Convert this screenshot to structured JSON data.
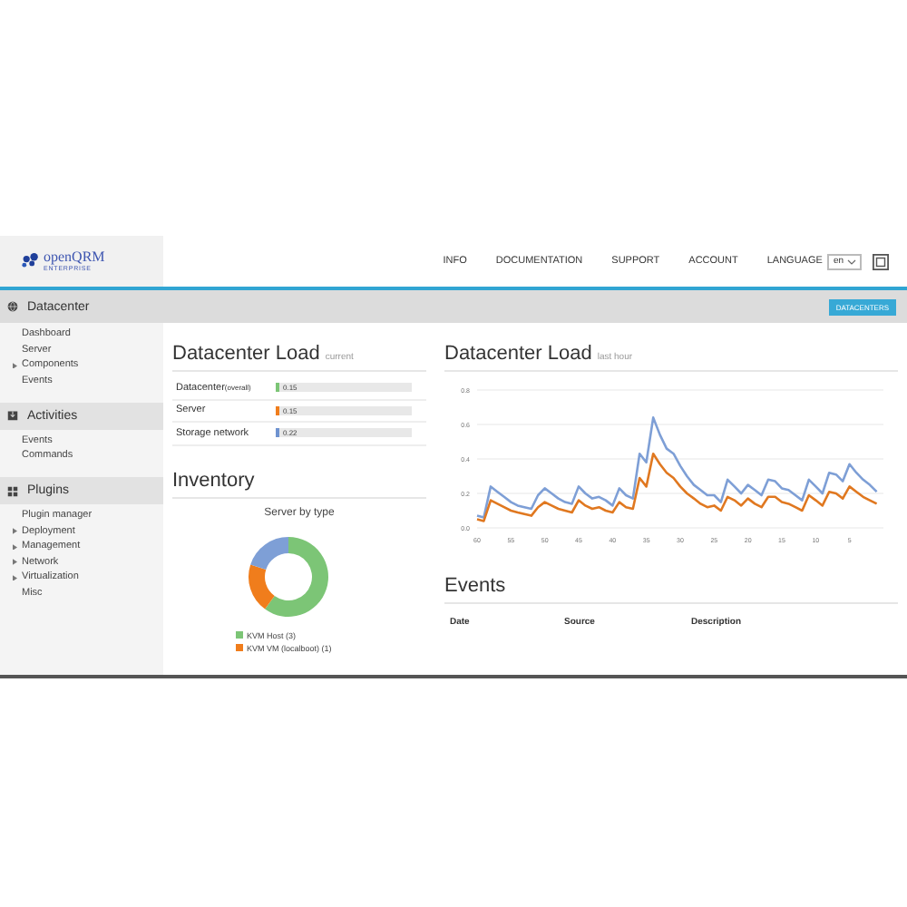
{
  "logo": {
    "name": "openQRM",
    "tagline": "ENTERPRISE"
  },
  "nav": [
    "INFO",
    "DOCUMENTATION",
    "SUPPORT",
    "ACCOUNT"
  ],
  "language": {
    "label": "LANGUAGE",
    "value": "en"
  },
  "toolbar": {
    "button": "DATACENTERS"
  },
  "sidebar": [
    {
      "title": "Datacenter",
      "items": [
        {
          "label": "Dashboard",
          "expandable": false
        },
        {
          "label": "Server",
          "expandable": false
        },
        {
          "label": "Components",
          "expandable": true
        },
        {
          "label": "Events",
          "expandable": false
        }
      ]
    },
    {
      "title": "Activities",
      "items": [
        {
          "label": "Events",
          "expandable": false
        },
        {
          "label": "Commands",
          "expandable": false
        }
      ]
    },
    {
      "title": "Plugins",
      "items": [
        {
          "label": "Plugin manager",
          "expandable": false
        },
        {
          "label": "Deployment",
          "expandable": true
        },
        {
          "label": "Management",
          "expandable": true
        },
        {
          "label": "Network",
          "expandable": true
        },
        {
          "label": "Virtualization",
          "expandable": true
        },
        {
          "label": "Misc",
          "expandable": false
        }
      ]
    }
  ],
  "load_current": {
    "title": "Datacenter Load",
    "subtitle": "current",
    "rows": [
      {
        "label": "Datacenter",
        "qualifier": "(overall)",
        "value": "0.15",
        "color": "#7cc576"
      },
      {
        "label": "Server",
        "qualifier": "",
        "value": "0.15",
        "color": "#f07d1c"
      },
      {
        "label": "Storage network",
        "qualifier": "",
        "value": "0.22",
        "color": "#6f93d0"
      }
    ]
  },
  "inventory": {
    "title": "Inventory",
    "chart_title": "Server by type",
    "legend": [
      {
        "label": "KVM Host (3)",
        "color": "#7cc576"
      },
      {
        "label": "KVM VM (localboot) (1)",
        "color": "#f07d1c"
      }
    ]
  },
  "load_hour": {
    "title": "Datacenter Load",
    "subtitle": "last hour",
    "chart_data": {
      "type": "line",
      "x": [
        60,
        59,
        58,
        57,
        56,
        55,
        54,
        53,
        52,
        51,
        50,
        49,
        48,
        47,
        46,
        45,
        44,
        43,
        42,
        41,
        40,
        39,
        38,
        37,
        36,
        35,
        34,
        33,
        32,
        31,
        30,
        29,
        28,
        27,
        26,
        25,
        24,
        23,
        22,
        21,
        20,
        19,
        18,
        17,
        16,
        15,
        14,
        13,
        12,
        11,
        10,
        9,
        8,
        7,
        6,
        5,
        4,
        3,
        2,
        1
      ],
      "xlim": [
        60,
        0
      ],
      "ylim": [
        0,
        0.8
      ],
      "grid": true,
      "xticks": [
        60,
        55,
        50,
        45,
        40,
        35,
        30,
        25,
        20,
        15,
        10,
        5
      ],
      "yticks": [
        {
          "value": 0,
          "label": "0.0"
        },
        {
          "value": 0.2,
          "label": "0.2"
        },
        {
          "value": 0.4,
          "label": "0.4"
        },
        {
          "value": 0.6,
          "label": "0.6"
        },
        {
          "value": 0.8,
          "label": "0.8"
        }
      ],
      "series": [
        {
          "color": "#7e9fd6",
          "values": [
            0.07,
            0.06,
            0.24,
            0.21,
            0.18,
            0.15,
            0.13,
            0.12,
            0.11,
            0.19,
            0.23,
            0.2,
            0.17,
            0.15,
            0.14,
            0.24,
            0.2,
            0.17,
            0.18,
            0.16,
            0.13,
            0.23,
            0.19,
            0.17,
            0.43,
            0.38,
            0.64,
            0.54,
            0.46,
            0.43,
            0.36,
            0.3,
            0.25,
            0.22,
            0.19,
            0.19,
            0.15,
            0.28,
            0.24,
            0.2,
            0.25,
            0.22,
            0.19,
            0.28,
            0.27,
            0.23,
            0.22,
            0.19,
            0.16,
            0.28,
            0.24,
            0.2,
            0.32,
            0.31,
            0.27,
            0.37,
            0.32,
            0.28,
            0.25,
            0.21
          ]
        },
        {
          "color": "#e07820",
          "values": [
            0.05,
            0.04,
            0.16,
            0.14,
            0.12,
            0.1,
            0.09,
            0.08,
            0.07,
            0.12,
            0.15,
            0.13,
            0.11,
            0.1,
            0.09,
            0.16,
            0.13,
            0.11,
            0.12,
            0.1,
            0.09,
            0.15,
            0.12,
            0.11,
            0.29,
            0.24,
            0.43,
            0.37,
            0.32,
            0.29,
            0.24,
            0.2,
            0.17,
            0.14,
            0.12,
            0.13,
            0.1,
            0.18,
            0.16,
            0.13,
            0.17,
            0.14,
            0.12,
            0.18,
            0.18,
            0.15,
            0.14,
            0.12,
            0.1,
            0.19,
            0.16,
            0.13,
            0.21,
            0.2,
            0.17,
            0.24,
            0.21,
            0.18,
            0.16,
            0.14
          ]
        }
      ]
    }
  },
  "events": {
    "title": "Events",
    "columns": [
      "Date",
      "Source",
      "Description"
    ]
  }
}
